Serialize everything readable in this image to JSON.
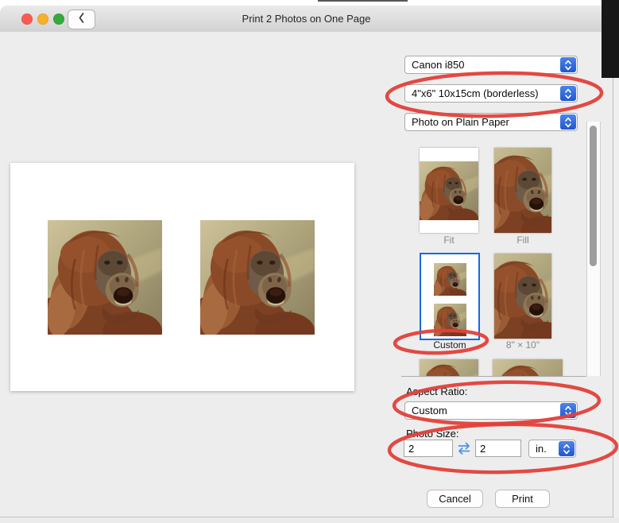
{
  "window": {
    "title": "Print 2 Photos on One Page"
  },
  "printer": {
    "value": "Canon i850"
  },
  "paper_size": {
    "value": "4\"x6\" 10x15cm (borderless)"
  },
  "media_type": {
    "value": "Photo on Plain Paper"
  },
  "layouts": [
    {
      "label": "Fit",
      "selected": false
    },
    {
      "label": "Fill",
      "selected": false
    },
    {
      "label": "Custom",
      "selected": true
    },
    {
      "label": "8\" × 10\"",
      "selected": false
    }
  ],
  "aspect_ratio": {
    "label": "Aspect Ratio:",
    "value": "Custom"
  },
  "photo_size": {
    "label": "Photo Size:",
    "width": "2",
    "height": "2",
    "unit": "in."
  },
  "buttons": {
    "cancel": "Cancel",
    "print": "Print"
  },
  "icons": {
    "back": "chevron-left-icon",
    "dropdown": "chevron-up-down-icon",
    "swap": "swap-arrows-icon",
    "traffic_lights": [
      "close-icon",
      "minimize-icon",
      "zoom-icon"
    ]
  },
  "colors": {
    "accent_blue": "#2a60d8",
    "selection_blue": "#1568e4",
    "annotation_red": "#e2403a",
    "titlebar_gray": "#d8d8d8",
    "content_gray": "#ededed"
  }
}
